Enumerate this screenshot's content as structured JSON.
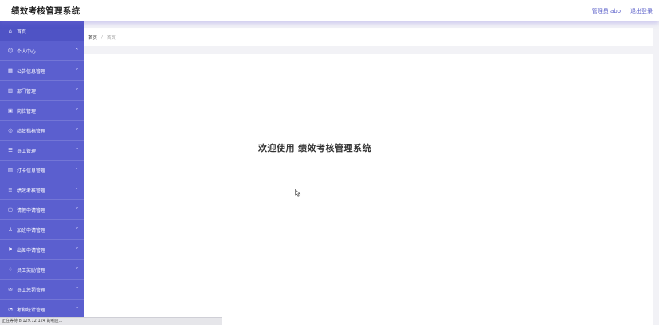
{
  "header": {
    "title": "绩效考核管理系统",
    "user_label": "管理员 abo",
    "logout_label": "退出登录"
  },
  "sidebar": {
    "items": [
      {
        "label": "首页",
        "icon": "home-icon",
        "glyph": "⌂",
        "chevron": ""
      },
      {
        "label": "个人中心",
        "icon": "user-icon",
        "glyph": "☺",
        "chevron": "^"
      },
      {
        "label": "公告信息管理",
        "icon": "grid-icon",
        "glyph": "▦",
        "chevron": "v"
      },
      {
        "label": "部门管理",
        "icon": "building-icon",
        "glyph": "▥",
        "chevron": "v"
      },
      {
        "label": "岗位管理",
        "icon": "briefcase-icon",
        "glyph": "▣",
        "chevron": "v"
      },
      {
        "label": "绩效指标管理",
        "icon": "target-icon",
        "glyph": "◎",
        "chevron": "v"
      },
      {
        "label": "员工管理",
        "icon": "list-icon",
        "glyph": "☰",
        "chevron": "v"
      },
      {
        "label": "打卡信息管理",
        "icon": "card-icon",
        "glyph": "▤",
        "chevron": "v"
      },
      {
        "label": "绩效考核管理",
        "icon": "menu-icon",
        "glyph": "≡",
        "chevron": "v"
      },
      {
        "label": "请假申请管理",
        "icon": "document-icon",
        "glyph": "▢",
        "chevron": "v"
      },
      {
        "label": "加班申请管理",
        "icon": "person-icon",
        "glyph": "♙",
        "chevron": "v"
      },
      {
        "label": "出差申请管理",
        "icon": "flag-icon",
        "glyph": "⚑",
        "chevron": "v"
      },
      {
        "label": "员工奖励管理",
        "icon": "award-icon",
        "glyph": "♢",
        "chevron": "v"
      },
      {
        "label": "员工惩罚管理",
        "icon": "mail-icon",
        "glyph": "✉",
        "chevron": "v"
      },
      {
        "label": "考勤统计管理",
        "icon": "chart-icon",
        "glyph": "◔",
        "chevron": "v"
      }
    ]
  },
  "breadcrumb": {
    "root": "首页",
    "separator": "/",
    "current": "首页"
  },
  "main": {
    "welcome_prefix": "欢迎使用",
    "welcome_app": "绩效考核管理系统"
  },
  "statusbar": {
    "text": "正在等待 8.129.12.124 的响应..."
  },
  "colors": {
    "sidebar": "#5b5fcf",
    "accent": "#5a5fc9"
  }
}
